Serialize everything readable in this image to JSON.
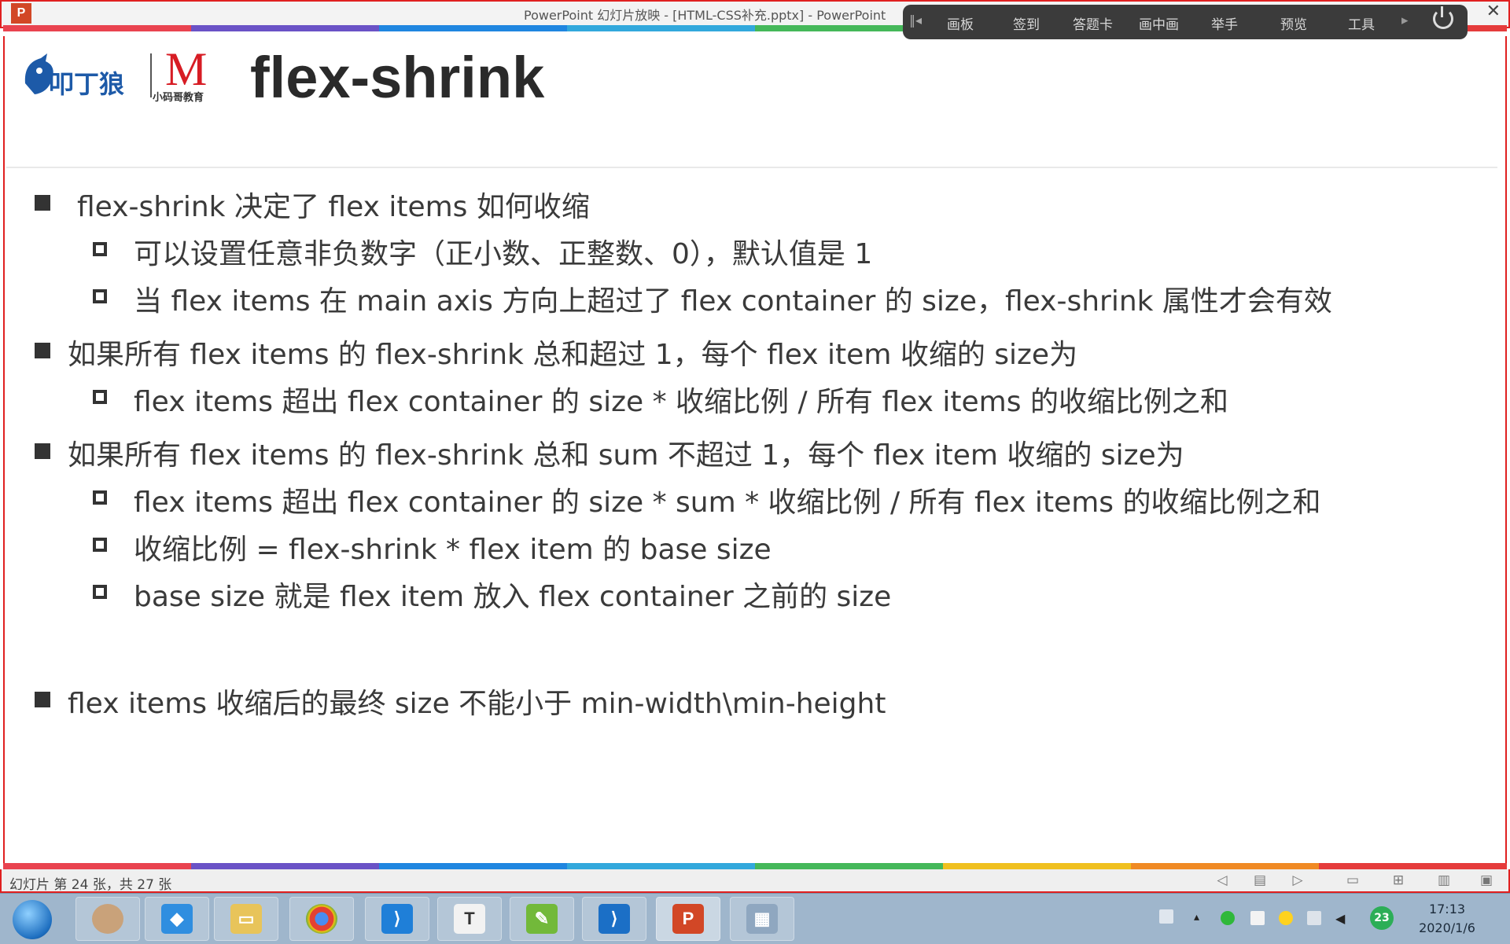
{
  "window": {
    "title": "PowerPoint 幻灯片放映 - [HTML-CSS补充.pptx] - PowerPoint",
    "app_icon": "P",
    "close_glyph": "✕"
  },
  "colors": {
    "stripe": [
      "#e9434f",
      "#6a52c6",
      "#1f86e0",
      "#32a8dc",
      "#45b85a",
      "#f0c020",
      "#f08a24",
      "#e53b3b"
    ],
    "accent_red": "#e02020"
  },
  "overlay_toolbar": {
    "items": [
      "画板",
      "签到",
      "答题卡",
      "画中画",
      "举手",
      "预览",
      "工具"
    ],
    "power_icon": "power-icon"
  },
  "slide": {
    "logo1_text": "叩丁狼",
    "logo2_text": "小码哥教育",
    "logo2_mark": "M",
    "title": "flex-shrink",
    "bullets": [
      "flex-shrink 决定了 flex items 如何收缩",
      "可以设置任意非负数字（正小数、正整数、0），默认值是 1",
      "当 flex items 在 main axis 方向上超过了 flex container 的 size，flex-shrink 属性才会有效",
      "如果所有 flex items 的 flex-shrink 总和超过 1，每个 flex item 收缩的 size为",
      "flex items 超出 flex container 的 size * 收缩比例 / 所有 flex items 的收缩比例之和",
      "如果所有 flex items 的 flex-shrink 总和 sum 不超过 1，每个 flex item 收缩的 size为",
      "flex items 超出 flex container 的 size * sum * 收缩比例 / 所有 flex items 的收缩比例之和",
      "收缩比例 = flex-shrink * flex item 的 base size",
      "base size 就是 flex item 放入 flex container 之前的 size",
      "flex items 收缩后的最终 size 不能小于 min-width\\min-height"
    ]
  },
  "statusbar": {
    "text": "幻灯片 第 24 张，共 27 张"
  },
  "taskbar": {
    "apps": [
      "avatar",
      "vpn-icon",
      "file-explorer-icon",
      "chrome-icon",
      "vscode-icon",
      "typora-icon",
      "notepad-icon",
      "vscode-icon",
      "powerpoint-icon",
      "calculator-icon"
    ],
    "time": "17:13",
    "date": "2020/1/6",
    "notification_count": "23"
  }
}
